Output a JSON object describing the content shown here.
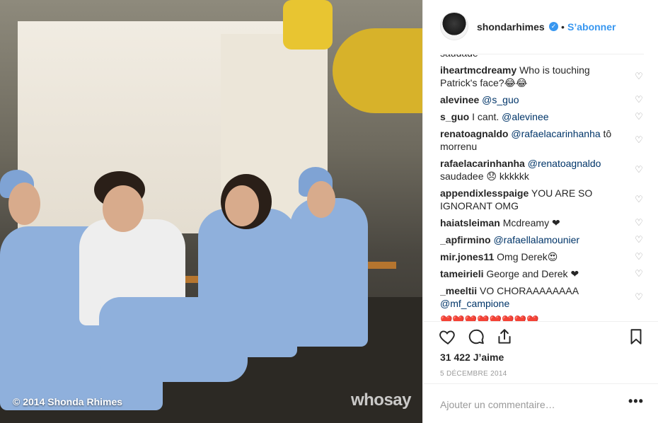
{
  "photo": {
    "caption": "© 2014 Shonda Rhimes",
    "watermark": "whosay"
  },
  "header": {
    "username": "shondarhimes",
    "verified_icon": "verified-badge-icon",
    "separator": "•",
    "follow_label": "S’abonner"
  },
  "comments": [
    {
      "author": "",
      "text": "saudade",
      "partial": true
    },
    {
      "author": "iheartmcdreamy",
      "text": "Who is touching Patrick's face?😂😂"
    },
    {
      "author": "alevinee",
      "mention": "@s_guo",
      "text": ""
    },
    {
      "author": "s_guo",
      "text": "I cant.",
      "mention": "@alevinee"
    },
    {
      "author": "renatoagnaldo",
      "mention": "@rafaelacarinhanha",
      "text": "tô morrenu"
    },
    {
      "author": "rafaelacarinhanha",
      "mention": "@renatoagnaldo",
      "text": "saudadee 😞 kkkkkk"
    },
    {
      "author": "appendixlesspaige",
      "text": "YOU ARE SO IGNORANT OMG"
    },
    {
      "author": "haiatsleiman",
      "text": "Mcdreamy ❤"
    },
    {
      "author": "_apfirmino",
      "mention": "@rafaellalamounier",
      "text": ""
    },
    {
      "author": "mir.jones11",
      "text": "Omg Derek😍"
    },
    {
      "author": "tameirieli",
      "text": "George and Derek ❤"
    },
    {
      "author": "_meeltii",
      "text": "VO CHORAAAAAAAA",
      "mention": "@mf_campione"
    },
    {
      "author": "",
      "text": "❤️❤️❤️❤️❤️❤️❤️❤️",
      "partial": true
    }
  ],
  "actions": {
    "like_icon": "heart-outline-icon",
    "comment_icon": "comment-bubble-icon",
    "share_icon": "share-icon",
    "save_icon": "bookmark-icon",
    "likes_text": "31 422 J’aime",
    "date_text": "5 décembre 2014"
  },
  "composer": {
    "placeholder": "Ajouter un commentaire…",
    "more_label": "•••"
  }
}
